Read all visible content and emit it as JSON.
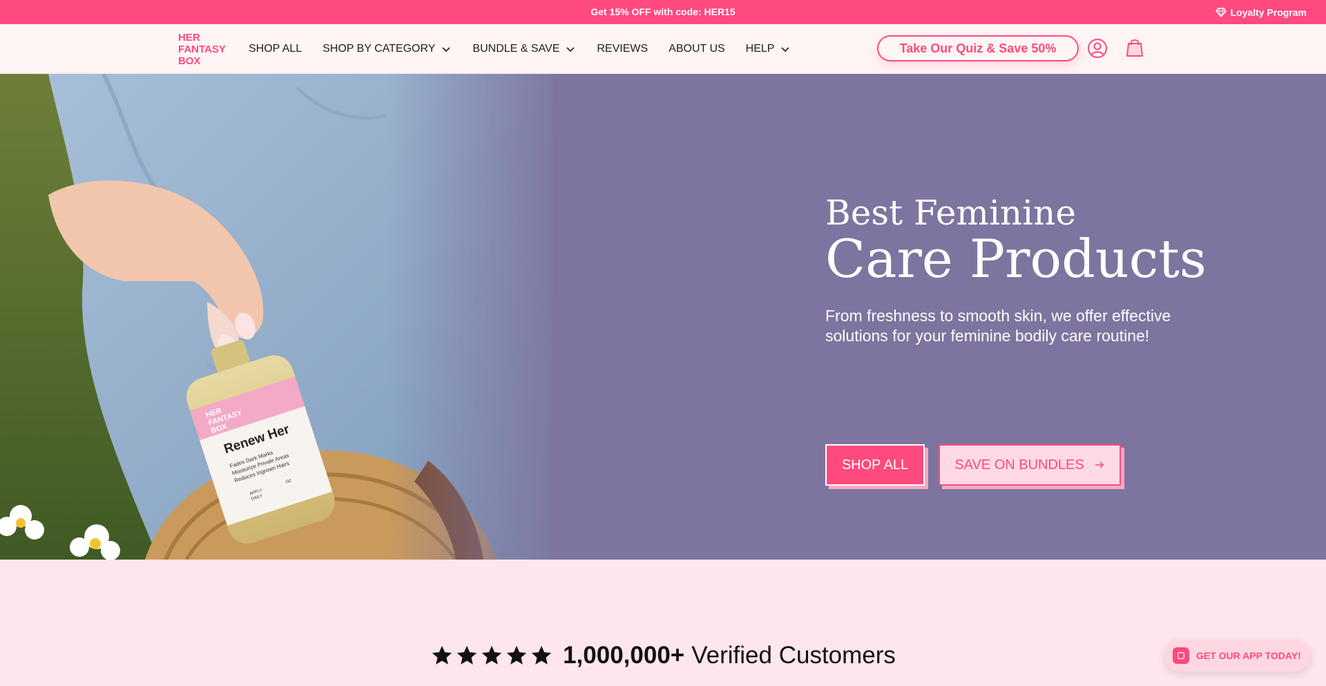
{
  "announcement": {
    "promo_text": "Get 15% OFF with code: HER15",
    "loyalty_label": "Loyalty Program"
  },
  "header": {
    "logo_lines": [
      "HER",
      "FANTASY",
      "BOX"
    ],
    "nav": [
      {
        "label": "SHOP ALL",
        "dropdown": false
      },
      {
        "label": "SHOP BY CATEGORY",
        "dropdown": true
      },
      {
        "label": "BUNDLE & SAVE",
        "dropdown": true
      },
      {
        "label": "REVIEWS",
        "dropdown": false
      },
      {
        "label": "ABOUT US",
        "dropdown": false
      },
      {
        "label": "HELP",
        "dropdown": true
      }
    ],
    "quiz_label": "Take Our Quiz & Save 50%",
    "icons": [
      "account-icon",
      "shopping-bag-icon"
    ]
  },
  "hero": {
    "title_line1": "Best Feminine",
    "title_line2": "Care Products",
    "subtitle": "From freshness to smooth skin, we offer effective solutions for your feminine bodily care routine!",
    "primary_button": "SHOP ALL",
    "secondary_button": "SAVE ON BUNDLES",
    "product": {
      "brand_lines": [
        "HER",
        "FANTASY",
        "BOX"
      ],
      "name": "Renew Her",
      "benefits": [
        "Fades Dark Marks",
        "Moisturize Private Areas",
        "Reduces Ingrown Hairs"
      ],
      "usage": [
        "APPLY",
        "DAILY"
      ],
      "size": [
        "OZ"
      ]
    }
  },
  "verified": {
    "stars": 5,
    "count": "1,000,000+",
    "label": "Verified Customers"
  },
  "app_badge": {
    "label": "GET OUR APP TODAY!"
  },
  "colors": {
    "brand_pink": "#ff4a7d",
    "hero_purple": "#7d759f",
    "page_bg": "#fde6ec",
    "header_bg": "#fff5f5"
  }
}
